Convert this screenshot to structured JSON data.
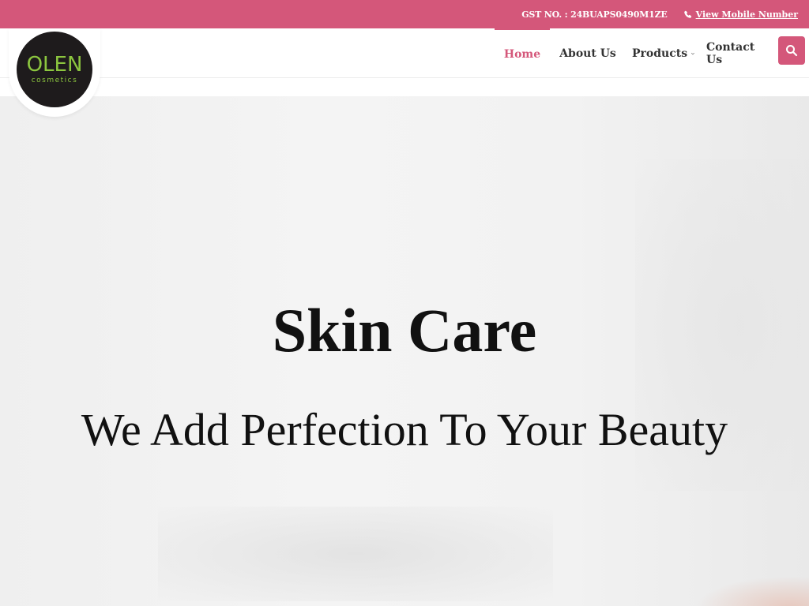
{
  "topbar": {
    "gst": "GST NO. : 24BUAPS0490M1ZE",
    "mobile_label": "View Mobile Number"
  },
  "logo": {
    "word": "OLEN",
    "sub": "cosmetics"
  },
  "nav": {
    "items": [
      {
        "label": "Home",
        "active": true
      },
      {
        "label": "About Us",
        "active": false
      },
      {
        "label": "Products",
        "active": false
      },
      {
        "label": "Contact Us",
        "active": false
      }
    ]
  },
  "hero": {
    "title": "Skin Care",
    "subtitle": "We Add Perfection To Your Beauty"
  },
  "colors": {
    "accent": "#d4577a",
    "logo_bg": "#1e1b1c",
    "logo_text": "#8cc63f"
  },
  "icons": {
    "phone": "phone-icon",
    "search": "search-icon",
    "chevron": "chevron-down-icon"
  }
}
